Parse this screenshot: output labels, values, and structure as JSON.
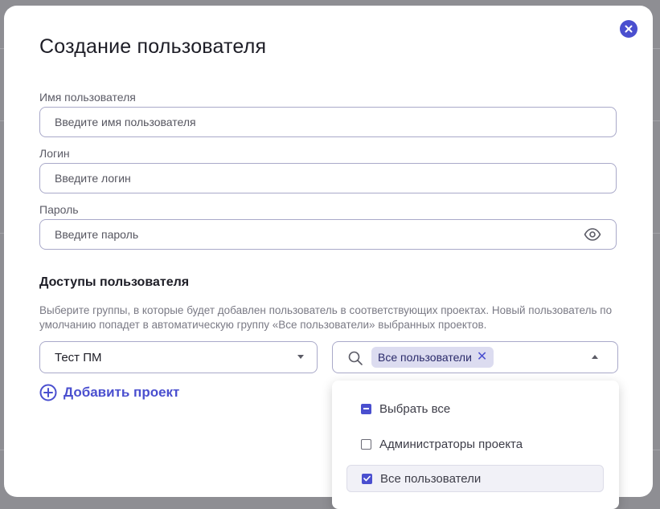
{
  "modal": {
    "title": "Создание пользователя",
    "close_icon": "close-icon"
  },
  "fields": {
    "username": {
      "label": "Имя пользователя",
      "placeholder": "Введите имя пользователя",
      "value": ""
    },
    "login": {
      "label": "Логин",
      "placeholder": "Введите логин",
      "value": ""
    },
    "password": {
      "label": "Пароль",
      "placeholder": "Введите пароль",
      "value": "",
      "toggle_icon": "eye-icon"
    }
  },
  "access": {
    "title": "Доступы пользователя",
    "description": "Выберите группы, в которые будет добавлен пользователь в соответствующих проектах. Новый пользователь по умолчанию попадет в автоматическую группу «Все пользователи» выбранных проектов.",
    "project_select": {
      "value": "Тест ПМ"
    },
    "groups_select": {
      "chips": [
        "Все пользователи"
      ],
      "options": [
        {
          "label": "Выбрать все",
          "state": "indeterminate"
        },
        {
          "label": "Администраторы проекта",
          "state": "unchecked"
        },
        {
          "label": "Все пользователи",
          "state": "checked"
        }
      ]
    },
    "add_project_label": "Добавить проект"
  },
  "colors": {
    "accent": "#4a4fcf",
    "backdrop": "#8e8e93",
    "border": "#a9a9c9",
    "chip_bg": "#dcdcf0"
  }
}
